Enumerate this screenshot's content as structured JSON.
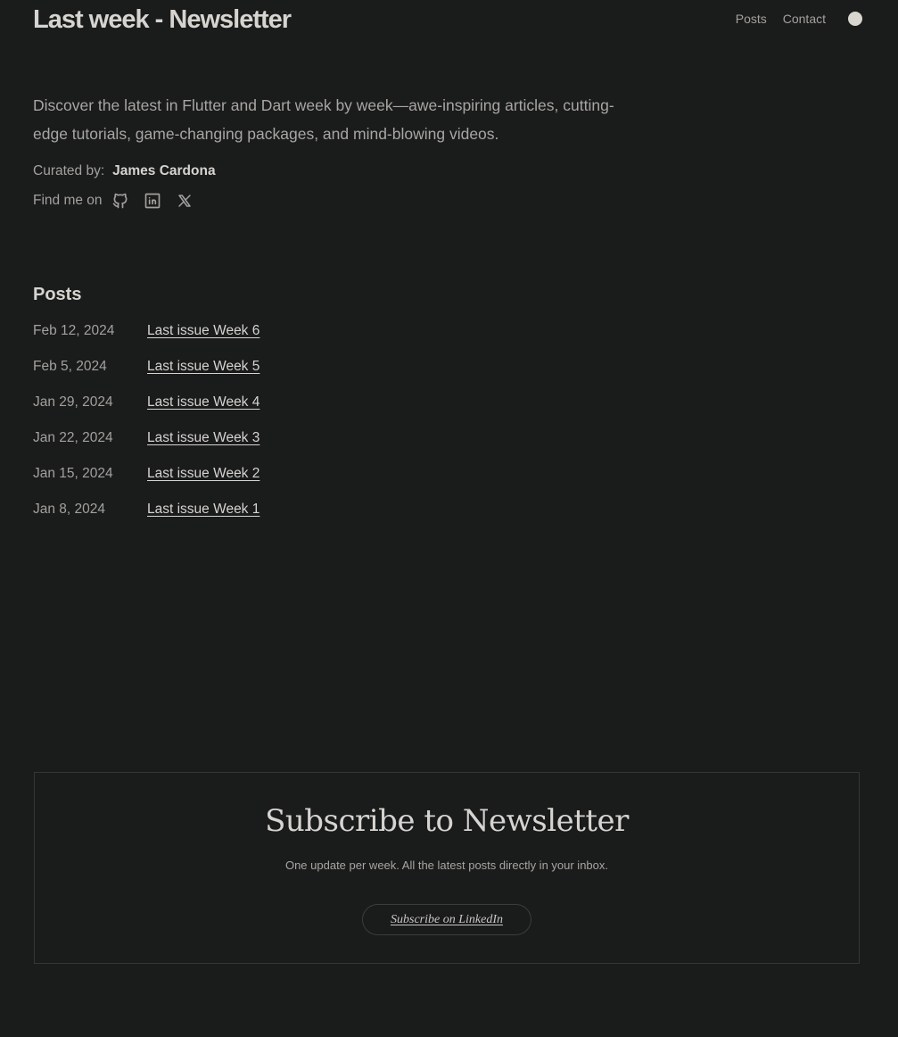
{
  "header": {
    "site_title": "Last week - Newsletter",
    "nav": [
      {
        "label": "Posts"
      },
      {
        "label": "Contact"
      }
    ]
  },
  "intro": {
    "description": "Discover the latest in Flutter and Dart week by week—awe-inspiring articles, cutting-edge tutorials, game-changing packages, and mind-blowing videos.",
    "curated_label": "Curated by:",
    "curator_name": "James Cardona",
    "find_me_label": "Find me on",
    "social_icons": [
      "github-icon",
      "linkedin-icon",
      "x-icon"
    ]
  },
  "posts": {
    "heading": "Posts",
    "items": [
      {
        "date": "Feb 12, 2024",
        "title": "Last issue Week 6"
      },
      {
        "date": "Feb 5, 2024",
        "title": "Last issue Week 5"
      },
      {
        "date": "Jan 29, 2024",
        "title": "Last issue Week 4"
      },
      {
        "date": "Jan 22, 2024",
        "title": "Last issue Week 3"
      },
      {
        "date": "Jan 15, 2024",
        "title": "Last issue Week 2"
      },
      {
        "date": "Jan 8, 2024",
        "title": "Last issue Week 1"
      }
    ]
  },
  "subscribe": {
    "title": "Subscribe to Newsletter",
    "description": "One update per week. All the latest posts directly in your inbox.",
    "button_label": "Subscribe on LinkedIn"
  },
  "colors": {
    "background": "#1a1b1b",
    "text_primary": "#d6d4d0",
    "text_secondary": "#a3a19d",
    "border": "#34363a",
    "toggle": "#d9d5cf"
  }
}
